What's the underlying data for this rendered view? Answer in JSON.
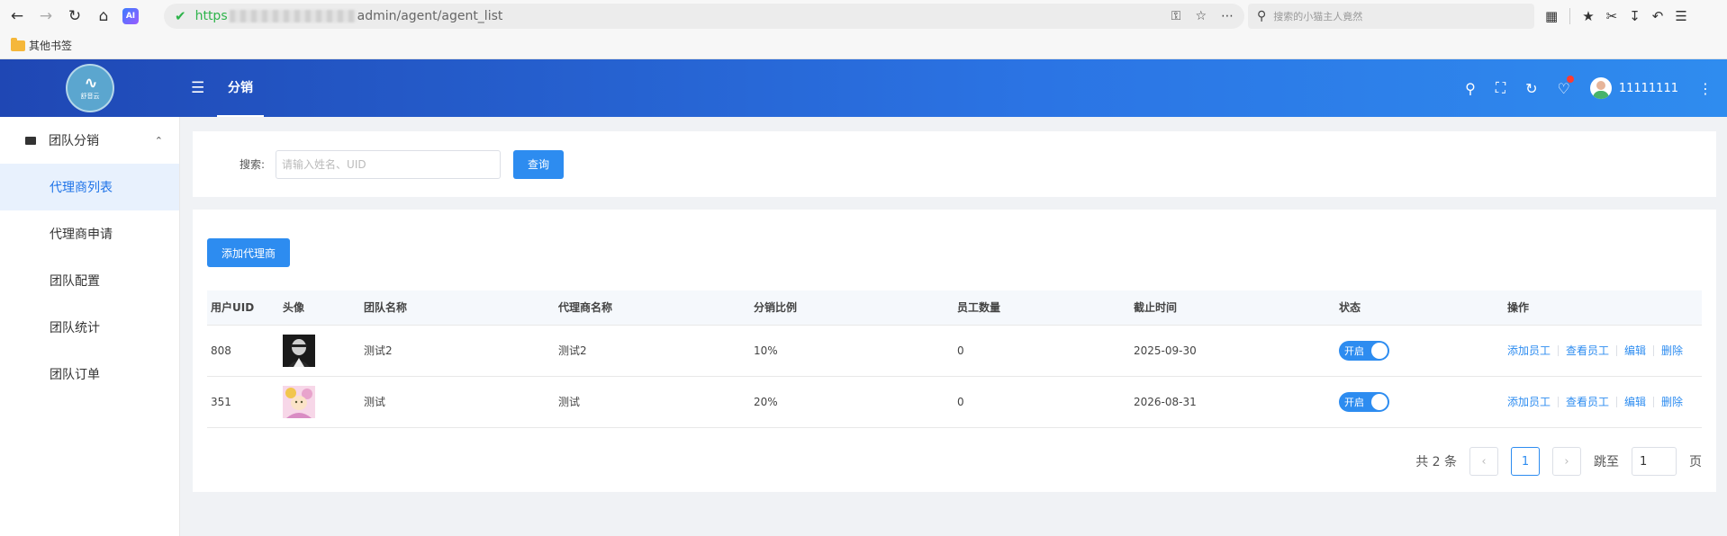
{
  "browser": {
    "url_proto": "https",
    "url_path": "admin/agent/agent_list",
    "search_placeholder": "搜索的小猫主人竟然",
    "bookmark_folder": "其他书签",
    "ai_label": "AI"
  },
  "header": {
    "tab_label": "分销",
    "username": "11111111",
    "logo_text": "舒音云"
  },
  "sidebar": {
    "group_label": "团队分销",
    "items": [
      {
        "label": "代理商列表",
        "active": true
      },
      {
        "label": "代理商申请",
        "active": false
      },
      {
        "label": "团队配置",
        "active": false
      },
      {
        "label": "团队统计",
        "active": false
      },
      {
        "label": "团队订单",
        "active": false
      }
    ]
  },
  "search": {
    "label": "搜索:",
    "placeholder": "请输入姓名、UID",
    "query_label": "查询"
  },
  "toolbar": {
    "add_label": "添加代理商"
  },
  "table": {
    "headers": [
      "用户UID",
      "头像",
      "团队名称",
      "代理商名称",
      "分销比例",
      "员工数量",
      "截止时间",
      "状态",
      "操作"
    ],
    "rows": [
      {
        "uid": "808",
        "team": "测试2",
        "agent": "测试2",
        "ratio": "10%",
        "staff": "0",
        "deadline": "2025-09-30",
        "status": "开启"
      },
      {
        "uid": "351",
        "team": "测试",
        "agent": "测试",
        "ratio": "20%",
        "staff": "0",
        "deadline": "2026-08-31",
        "status": "开启"
      }
    ],
    "ops": [
      "添加员工",
      "查看员工",
      "编辑",
      "删除"
    ]
  },
  "pager": {
    "total_text": "共 2 条",
    "current_page": "1",
    "jump_label": "跳至",
    "jump_value": "1",
    "page_unit": "页"
  },
  "colors": {
    "primary": "#2d8cf0",
    "header_start": "#1f47b4",
    "header_end": "#2f8cef",
    "active_bg": "#e8f1fd"
  }
}
